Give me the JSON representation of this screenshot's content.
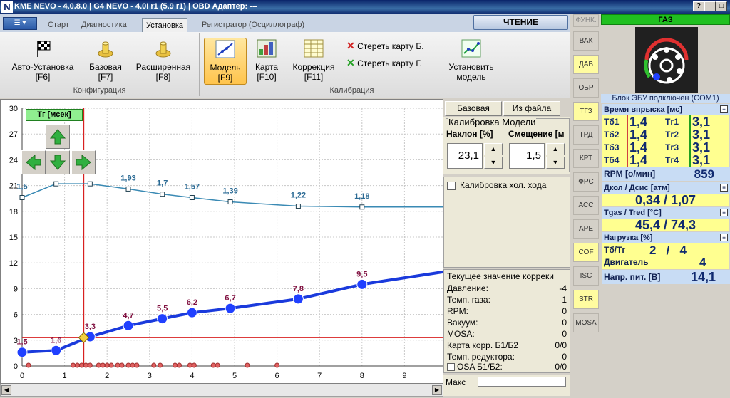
{
  "window": {
    "title": "KME NEVO - 4.0.8.0  |  G4 NEVO - 4.0I r1 (5.9 r1)  |  OBD Адаптер: ---",
    "logo": "N",
    "buttons": {
      "help": "?",
      "minimize": "_",
      "maximize": "□",
      "close": "×"
    }
  },
  "tabs": [
    {
      "label": "Старт",
      "active": false
    },
    {
      "label": "Диагностика",
      "active": false
    },
    {
      "label": "Установка",
      "active": true
    },
    {
      "label": "Регистратор (Осциллограф)",
      "active": false
    }
  ],
  "menu_button": "☰ ▾",
  "read_button": "ЧТЕНИЕ",
  "ribbon": {
    "config_group": "Конфигурация",
    "calib_group": "Калибрация",
    "buttons": [
      {
        "label": "Авто-Установка",
        "key": "[F6]",
        "icon": "checkered-flag-icon"
      },
      {
        "label": "Базовая",
        "key": "[F7]",
        "icon": "knob-icon"
      },
      {
        "label": "Расширенная",
        "key": "[F8]",
        "icon": "knob-icon"
      },
      {
        "label": "Модель",
        "key": "[F9]",
        "icon": "model-chart-icon",
        "selected": true
      },
      {
        "label": "Карта",
        "key": "[F10]",
        "icon": "map-icon"
      },
      {
        "label": "Коррекция",
        "key": "[F11]",
        "icon": "correction-table-icon"
      }
    ],
    "erase_b": "Стереть карту Б.",
    "erase_g": "Стереть карту Г.",
    "set_model": "Установить",
    "set_model2": "модель"
  },
  "chart_label": "Тг [мсек]",
  "chart_data": {
    "type": "line",
    "x_ticks": [
      "0",
      "1",
      "2",
      "3",
      "4",
      "5",
      "6",
      "7",
      "8",
      "9"
    ],
    "y_ticks": [
      "0",
      "3",
      "6",
      "9",
      "12",
      "15",
      "18",
      "21",
      "24",
      "27",
      "30"
    ],
    "xlim": [
      0,
      10
    ],
    "ylim": [
      0,
      30
    ],
    "grid": true,
    "series": [
      {
        "color": "#3a8ab4",
        "points": [
          [
            0,
            19.6
          ],
          [
            0.8,
            21.2
          ],
          [
            1.6,
            21.2
          ],
          [
            2.5,
            20.6
          ],
          [
            3.3,
            20.0
          ],
          [
            4.0,
            19.6
          ],
          [
            4.9,
            19.1
          ],
          [
            6.5,
            18.6
          ],
          [
            8.0,
            18.5
          ],
          [
            10.5,
            18.5
          ]
        ],
        "labels": [
          [
            0,
            "1,5"
          ],
          [
            2.5,
            "1,93"
          ],
          [
            3.3,
            "1,7"
          ],
          [
            4.0,
            "1,57"
          ],
          [
            4.9,
            "1,39"
          ],
          [
            6.5,
            "1,22"
          ],
          [
            8.0,
            "1,18"
          ]
        ]
      },
      {
        "color": "#1a3adc",
        "points": [
          [
            0,
            1.6
          ],
          [
            0.8,
            1.8
          ],
          [
            1.6,
            3.4
          ],
          [
            2.5,
            4.7
          ],
          [
            3.3,
            5.5
          ],
          [
            4.0,
            6.2
          ],
          [
            4.9,
            6.7
          ],
          [
            6.5,
            7.8
          ],
          [
            8.0,
            9.5
          ],
          [
            10.5,
            11.4
          ]
        ],
        "labels": [
          [
            0,
            "1,5"
          ],
          [
            0.8,
            "1,6"
          ],
          [
            1.6,
            "3,3"
          ],
          [
            2.5,
            "4,7"
          ],
          [
            3.3,
            "5,5"
          ],
          [
            4.0,
            "6,2"
          ],
          [
            4.9,
            "6,7"
          ],
          [
            6.5,
            "7,8"
          ],
          [
            8.0,
            "9,5"
          ]
        ]
      }
    ],
    "scatter_x": [
      0.15,
      1.2,
      1.3,
      1.4,
      1.5,
      1.6,
      1.8,
      1.9,
      2.0,
      2.1,
      2.25,
      2.35,
      2.5,
      2.6,
      2.7,
      3.1,
      3.25,
      3.6,
      3.7,
      3.95,
      4.05,
      4.5,
      4.6,
      5.3,
      6.0
    ],
    "cursor": {
      "x": 1.45,
      "y": 3.3
    }
  },
  "panel": {
    "base_btn": "Базовая",
    "file_btn": "Из файла",
    "calib_title": "Калибровка Модели",
    "slope_label": "Наклон [%]",
    "offset_label": "Смещение [м",
    "slope_value": "23,1",
    "offset_value": "1,5",
    "idle_label": "Калибровка хол. хода",
    "curr_title": "Текущее значение корреки",
    "rows": [
      {
        "label": "Давление:",
        "value": "-4"
      },
      {
        "label": "Темп. газа:",
        "value": "1"
      },
      {
        "label": "RPM:",
        "value": "0"
      },
      {
        "label": "Вакуум:",
        "value": "0"
      },
      {
        "label": "MOSA:",
        "value": "0"
      },
      {
        "label": "Карта корр. Б1/Б2",
        "value": "0/0"
      },
      {
        "label": "Темп. редуктора:",
        "value": "0"
      },
      {
        "label": "OSA Б1/Б2:",
        "value": "0/0"
      }
    ],
    "max_label": "Макс"
  },
  "vtabs": [
    {
      "label": "ФУНК.",
      "y": false
    },
    {
      "label": "ВАК",
      "y": false
    },
    {
      "label": "ДАВ",
      "y": true
    },
    {
      "label": "ОБР",
      "y": false
    },
    {
      "label": "ТГЗ",
      "y": true
    },
    {
      "label": "ТРД",
      "y": false
    },
    {
      "label": "КРТ",
      "y": false
    },
    {
      "label": "ФРС",
      "y": false
    },
    {
      "label": "АСС",
      "y": false
    },
    {
      "label": "АРЕ",
      "y": false
    },
    {
      "label": "COF",
      "y": true
    },
    {
      "label": "ISC",
      "y": false
    },
    {
      "label": "STR",
      "y": true
    },
    {
      "label": "MOSA",
      "y": false
    }
  ],
  "right": {
    "gas_header": "ГАЗ",
    "ecu_status": "Блок ЭБУ подключен (COM1)",
    "inj_label": "Время впрыска [мс]",
    "inj": [
      {
        "tb": "Тб1",
        "vb": "1,4",
        "tg": "Тг1",
        "vg": "3,1"
      },
      {
        "tb": "Тб2",
        "vb": "1,4",
        "tg": "Тг2",
        "vg": "3,1"
      },
      {
        "tb": "Тб3",
        "vb": "1,4",
        "tg": "Тг3",
        "vg": "3,1"
      },
      {
        "tb": "Тб4",
        "vb": "1,4",
        "tg": "Тг4",
        "vg": "3,1"
      }
    ],
    "rpm_label": "RPM [о/мин]",
    "rpm_value": "859",
    "press_label": "Дкол / Дсис [атм]",
    "press_value": "0,34 / 1,07",
    "temp_label": "Tgas / Tred [°C]",
    "temp_value": "45,4 / 74,3",
    "load_label": "Нагрузка [%]",
    "load_row1_label": "Тб/Тг",
    "load_row1_value": "2   /   4",
    "load_row2_label": "Двигатель",
    "load_row2_value": "4",
    "volt_label": "Напр. пит. [В]",
    "volt_value": "14,1",
    "expand": "≡"
  },
  "colors": {
    "accent_blue": "#1a3adc",
    "teal": "#3a8ab4",
    "red": "#d82020",
    "yellow": "#ffff90"
  }
}
